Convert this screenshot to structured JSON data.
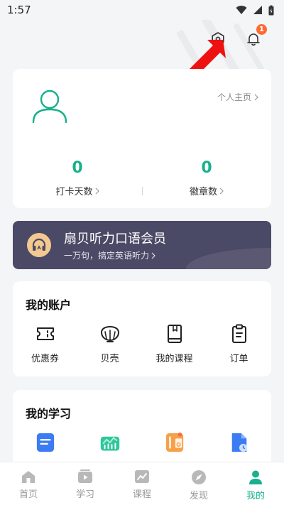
{
  "status_bar": {
    "time": "1:57"
  },
  "colors": {
    "accent": "#19b08c",
    "badge": "#ff6a33",
    "vip_bg": "#4b4a66",
    "annotation": "#ee1111"
  },
  "top_actions": {
    "notification_count": "1"
  },
  "profile": {
    "homepage_link": "个人主页",
    "stats": [
      {
        "value": "0",
        "label": "打卡天数"
      },
      {
        "value": "0",
        "label": "徽章数"
      }
    ]
  },
  "vip": {
    "title": "扇贝听力口语会员",
    "subtitle": "一万句，搞定英语听力"
  },
  "account": {
    "title": "我的账户",
    "items": [
      {
        "label": "优惠券",
        "icon": "ticket-icon"
      },
      {
        "label": "贝壳",
        "icon": "shell-icon"
      },
      {
        "label": "我的课程",
        "icon": "book-icon"
      },
      {
        "label": "订单",
        "icon": "clipboard-icon"
      }
    ]
  },
  "study": {
    "title": "我的学习"
  },
  "tabs": [
    {
      "label": "首页",
      "icon": "home-icon"
    },
    {
      "label": "学习",
      "icon": "play-icon"
    },
    {
      "label": "课程",
      "icon": "chart-icon"
    },
    {
      "label": "发现",
      "icon": "compass-icon"
    },
    {
      "label": "我的",
      "icon": "person-icon"
    }
  ]
}
